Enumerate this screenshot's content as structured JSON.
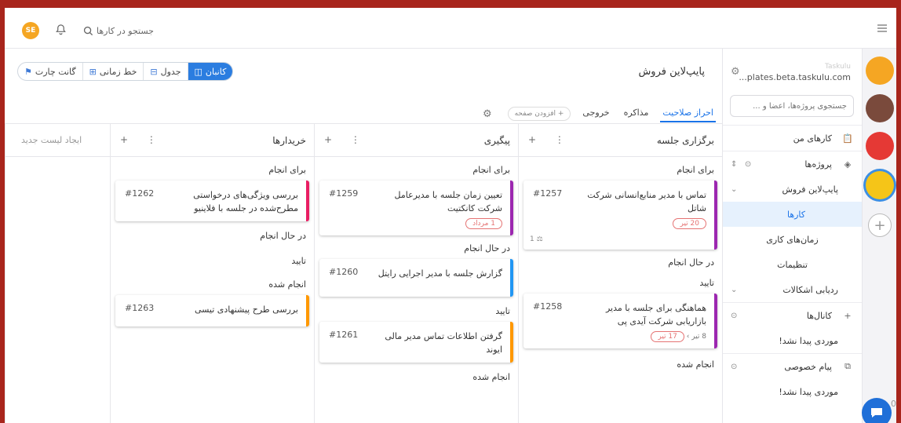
{
  "topbar": {
    "avatar_initials": "SE",
    "search_label": "جستجو در کارها",
    "icons": [
      "hamburger-icon",
      "bell-icon",
      "search-icon"
    ]
  },
  "rail": {
    "add_label": "+",
    "chat_badge": "0",
    "workspace_colors": [
      "#f5a623",
      "#7a4a3c",
      "#e53935",
      "#f5c518"
    ],
    "icons": [
      "plus-icon",
      "chat-icon"
    ]
  },
  "sidebar": {
    "org_name": "Taskulu",
    "org_url": "...plates.beta.taskulu.com",
    "search_placeholder": "جستجوی پروژه‌ها، اعضا و ...",
    "my_tasks": "کارهای من",
    "projects": "پروژه‌ها",
    "project_name": "پایپ‌لاین فروش",
    "nav": {
      "tasks": "کارها",
      "timelines": "زمان‌های کاری",
      "settings": "تنظیمات"
    },
    "issue_tracking": "ردیابی اشکالات",
    "channels": "کانال‌ها",
    "channels_empty": "موردی پیدا نشد!",
    "private_messages": "پیام خصوصی",
    "pm_empty": "موردی پیدا نشد!",
    "icons": [
      "gear-icon",
      "clipboard-icon",
      "layers-icon",
      "chevron-down-icon",
      "plus-icon",
      "copy-icon",
      "sort-icon",
      "add-circle-icon"
    ]
  },
  "page": {
    "title": "پایپ‌لاین فروش",
    "views": [
      {
        "label": "کانبان",
        "active": true
      },
      {
        "label": "جدول",
        "active": false
      },
      {
        "label": "خط زمانی",
        "active": false
      },
      {
        "label": "گانت چارت",
        "active": false
      }
    ],
    "tabs": [
      {
        "label": "احراز صلاحیت",
        "active": true
      },
      {
        "label": "مذاکره",
        "active": false
      },
      {
        "label": "خروجی",
        "active": false
      }
    ],
    "add_page": "+ افزودن صفحه"
  },
  "board": {
    "new_list": "ایجاد لیست جدید",
    "columns": [
      {
        "title": "برگزاری جلسه",
        "groups": {
          "todo": "برای انجام",
          "doing": "در حال انجام",
          "approve": "تایید",
          "done": "انجام شده"
        },
        "cards": [
          {
            "title": "تماس با مدیر منابع‌انسانی شرکت شاتل",
            "num": "#1257",
            "color": "#9c27b0",
            "tag": "20 تیر",
            "sub": "1 ⚖"
          },
          {
            "title": "هماهنگی برای جلسه با مدیر بازاریابی شرکت آیدی پی",
            "num": "#1258",
            "color": "#9c27b0",
            "tag": "17 تیر",
            "meta": "8 تیر ›"
          }
        ]
      },
      {
        "title": "پیگیری",
        "groups": {
          "todo": "برای انجام",
          "doing": "در حال انجام",
          "approve": "تایید",
          "done": "انجام شده"
        },
        "cards": [
          {
            "title": "تعیین زمان جلسه با مدیرعامل شرکت کانکتیت",
            "num": "#1259",
            "color": "#9c27b0",
            "tag": "1 مرداد"
          },
          {
            "title": "گزارش جلسه با مدیر اجرایی رایتل",
            "num": "#1260",
            "color": "#2196f3"
          },
          {
            "title": "گرفتن اطلاعات تماس مدیر مالی ایوند",
            "num": "#1261",
            "color": "#ff9800"
          }
        ]
      },
      {
        "title": "خریدارها",
        "groups": {
          "todo": "برای انجام",
          "doing": "در حال انجام",
          "approve": "تایید",
          "done": "انجام شده"
        },
        "cards": [
          {
            "title": "بررسی ویژگی‌های درخواستی مطرح‌شده در جلسه با فلاینیو",
            "num": "#1262",
            "color": "#e91e63"
          },
          {
            "title": "بررسی طرح پیشنهادی تیسی",
            "num": "#1263",
            "color": "#ff9800"
          }
        ]
      }
    ]
  }
}
